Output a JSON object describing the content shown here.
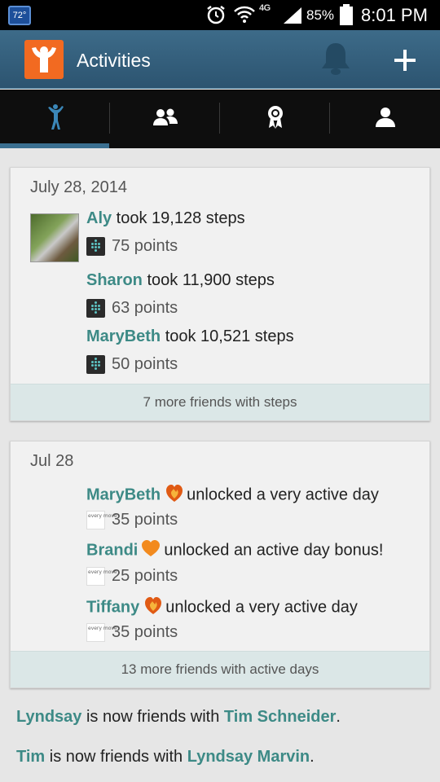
{
  "status_bar": {
    "temperature": "72°",
    "network": "4G",
    "battery": "85%",
    "time": "8:01 PM"
  },
  "app_bar": {
    "title": "Activities",
    "icons": [
      "app-logo-icon",
      "bell-icon",
      "plus-icon"
    ]
  },
  "tabs": [
    {
      "name": "activity-tab",
      "icon": "runner-icon",
      "active": true
    },
    {
      "name": "friends-tab",
      "icon": "people-icon",
      "active": false
    },
    {
      "name": "achievements-tab",
      "icon": "award-ribbon-icon",
      "active": false
    },
    {
      "name": "profile-tab",
      "icon": "person-icon",
      "active": false
    }
  ],
  "cards": [
    {
      "date": "July 28, 2014",
      "entries": [
        {
          "name": "Aly",
          "text": " took 19,128 steps",
          "points": "75 points",
          "source": "fitbit-icon"
        },
        {
          "name": "Sharon",
          "text": " took 11,900 steps",
          "points": "63 points",
          "source": "fitbit-icon"
        },
        {
          "name": "MaryBeth",
          "text": " took 10,521 steps",
          "points": "50 points",
          "source": "fitbit-icon"
        }
      ],
      "more": "7 more friends with steps"
    },
    {
      "date": "Jul 28",
      "entries": [
        {
          "name": "MaryBeth",
          "text": "unlocked a very active day",
          "points": "35 points",
          "source": "everymove-icon",
          "badge": "flame-heart-icon"
        },
        {
          "name": "Brandi",
          "text": "unlocked an active day bonus!",
          "points": "25 points",
          "source": "everymove-icon",
          "badge": "orange-heart-icon"
        },
        {
          "name": "Tiffany",
          "text": "unlocked a very active day",
          "points": "35 points",
          "source": "everymove-icon",
          "badge": "flame-heart-icon"
        }
      ],
      "more": "13 more friends with active days"
    }
  ],
  "feed": [
    {
      "name1": "Lyndsay",
      "text": " is now friends with ",
      "name2": "Tim Schneider",
      "end": "."
    },
    {
      "name1": "Tim",
      "text": " is now friends with ",
      "name2": "Lyndsay Marvin",
      "end": "."
    }
  ],
  "source_logo_text": "every move",
  "colors": {
    "accent": "#3d8a86",
    "appbar": "#2f5a77",
    "logo": "#f26a21",
    "more_bg": "#dbe7e7"
  }
}
